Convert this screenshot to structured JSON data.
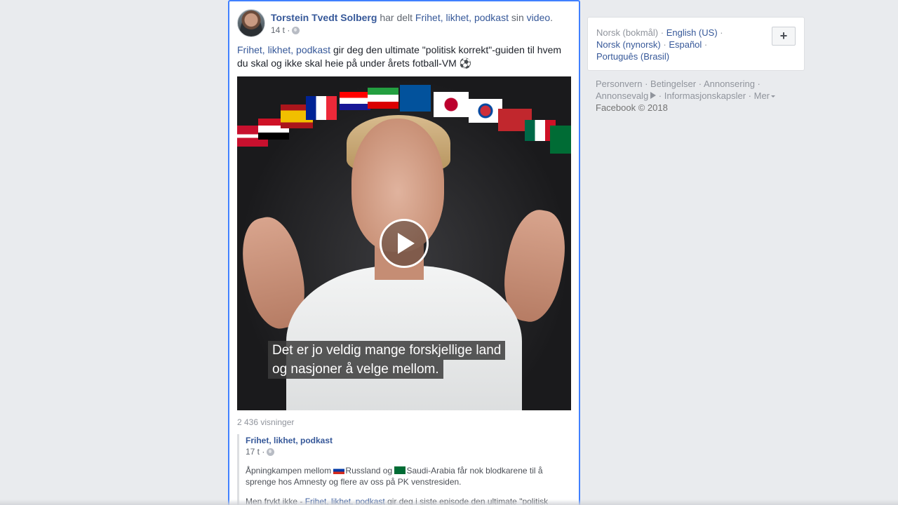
{
  "post": {
    "author": "Torstein Tvedt Solberg",
    "shared_text": "har delt",
    "page_link": "Frihet, likhet, podkast",
    "possessive": "sin",
    "video_link": "video",
    "period": ".",
    "time": "14 t ·",
    "text_link": "Frihet, likhet, podkast",
    "text_body": " gir deg den ultimate \"politisk korrekt\"-guiden til hvem du skal og ikke skal heie på under årets fotball-VM ⚽",
    "video": {
      "subtitle_line1": "Det er jo veldig mange forskjellige land",
      "subtitle_line2": "og nasjoner å velge mellom."
    },
    "views": "2 436 visninger",
    "shared_post": {
      "page": "Frihet, likhet, podkast",
      "time": "17 t ·",
      "p1_a": "Åpningkampen mellom ",
      "p1_b": "Russland og ",
      "p1_c": "Saudi-Arabia får nok blodkarene til å sprenge hos Amnesty og flere av oss på PK venstresiden.",
      "p2_a": "Men frykt ikke - ",
      "p2_link": "Frihet, likhet, podkast",
      "p2_b": " gir deg i siste episode den ultimate \"politisk"
    }
  },
  "languages": {
    "current": "Norsk (bokmål)",
    "english": "English (US)",
    "nynorsk": "Norsk (nynorsk)",
    "spanish": "Español",
    "portuguese": "Português (Brasil)",
    "add_label": "+"
  },
  "footer": {
    "privacy": "Personvern",
    "terms": "Betingelser",
    "advertising": "Annonsering",
    "ad_choices": "Annonsevalg",
    "cookies": "Informasjonskapsler",
    "more": "Mer",
    "copyright": "Facebook © 2018"
  },
  "colors": {
    "link": "#365899",
    "card_focus_border": "#4080ff",
    "background": "#e9ebee"
  }
}
